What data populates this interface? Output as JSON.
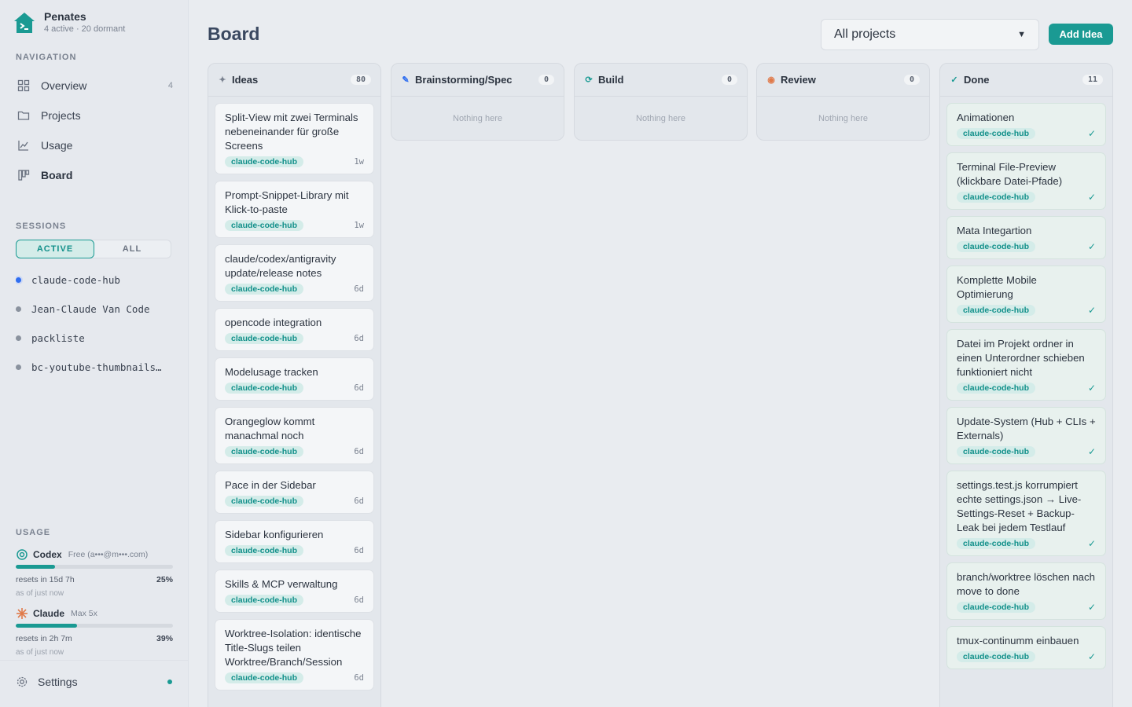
{
  "brand": {
    "title": "Penates",
    "subtitle": "4 active · 20 dormant"
  },
  "navigation": {
    "label": "NAVIGATION",
    "items": [
      {
        "label": "Overview",
        "count": "4",
        "icon": "grid-icon"
      },
      {
        "label": "Projects",
        "icon": "folder-icon"
      },
      {
        "label": "Usage",
        "icon": "chart-icon"
      },
      {
        "label": "Board",
        "icon": "board-icon"
      }
    ]
  },
  "sessions": {
    "label": "SESSIONS",
    "tabs": [
      "ACTIVE",
      "ALL"
    ],
    "items": [
      {
        "name": "claude-code-hub",
        "live": true
      },
      {
        "name": "Jean-Claude Van Code",
        "live": false
      },
      {
        "name": "packliste",
        "live": false
      },
      {
        "name": "bc-youtube-thumbnails…",
        "live": false
      }
    ]
  },
  "usage": {
    "label": "USAGE",
    "providers": [
      {
        "name": "Codex",
        "plan": "Free (a•••@m•••.com)",
        "resets": "resets in 15d 7h",
        "percent_label": "25%",
        "percent": 25,
        "asof": "as of just now",
        "color": "#1a9a93"
      },
      {
        "name": "Claude",
        "plan": "Max 5x",
        "resets": "resets in 2h 7m",
        "percent_label": "39%",
        "percent": 39,
        "asof": "as of just now",
        "color": "#e07a4a"
      }
    ]
  },
  "settings": {
    "label": "Settings"
  },
  "header": {
    "title": "Board",
    "project_filter": "All projects",
    "add_label": "Add Idea"
  },
  "columns": [
    {
      "title": "Ideas",
      "count": "80",
      "icon": "✦",
      "icon_color": "#7a8290",
      "empty": ""
    },
    {
      "title": "Brainstorming/Spec",
      "count": "0",
      "icon": "✎",
      "icon_color": "#2f6ef0",
      "empty": "Nothing here"
    },
    {
      "title": "Build",
      "count": "0",
      "icon": "⟳",
      "icon_color": "#1a9a93",
      "empty": "Nothing here"
    },
    {
      "title": "Review",
      "count": "0",
      "icon": "◉",
      "icon_color": "#e07a4a",
      "empty": "Nothing here"
    },
    {
      "title": "Done",
      "count": "11",
      "icon": "✓",
      "icon_color": "#1a9a93",
      "empty": ""
    }
  ],
  "ideas": [
    {
      "title": "Split-View mit zwei Terminals nebeneinander für große Screens",
      "tag": "claude-code-hub",
      "age": "1w"
    },
    {
      "title": "Prompt-Snippet-Library mit Klick-to-paste",
      "tag": "claude-code-hub",
      "age": "1w"
    },
    {
      "title": "claude/codex/antigravity update/release notes",
      "tag": "claude-code-hub",
      "age": "6d"
    },
    {
      "title": "opencode integration",
      "tag": "claude-code-hub",
      "age": "6d"
    },
    {
      "title": "Modelusage tracken",
      "tag": "claude-code-hub",
      "age": "6d"
    },
    {
      "title": "Orangeglow kommt manachmal noch",
      "tag": "claude-code-hub",
      "age": "6d"
    },
    {
      "title": "Pace in der Sidebar",
      "tag": "claude-code-hub",
      "age": "6d"
    },
    {
      "title": "Sidebar konfigurieren",
      "tag": "claude-code-hub",
      "age": "6d"
    },
    {
      "title": "Skills & MCP verwaltung",
      "tag": "claude-code-hub",
      "age": "6d"
    },
    {
      "title": "Worktree-Isolation: identische Title-Slugs teilen Worktree/Branch/Session",
      "tag": "claude-code-hub",
      "age": "6d"
    }
  ],
  "done": [
    {
      "title": "Animationen",
      "tag": "claude-code-hub"
    },
    {
      "title": "Terminal File-Preview (klickbare Datei-Pfade)",
      "tag": "claude-code-hub"
    },
    {
      "title": "Mata Integartion",
      "tag": "claude-code-hub"
    },
    {
      "title": "Komplette Mobile Optimierung",
      "tag": "claude-code-hub"
    },
    {
      "title": "Datei im Projekt ordner in einen Unterordner schieben funktioniert nicht",
      "tag": "claude-code-hub"
    },
    {
      "title": "Update-System (Hub + CLIs + Externals)",
      "tag": "claude-code-hub"
    },
    {
      "title": "settings.test.js korrumpiert echte settings.json → Live-Settings-Reset + Backup-Leak bei jedem Testlauf",
      "tag": "claude-code-hub"
    },
    {
      "title": "branch/worktree löschen nach move to done",
      "tag": "claude-code-hub"
    },
    {
      "title": "tmux-continumm einbauen",
      "tag": "claude-code-hub"
    }
  ]
}
